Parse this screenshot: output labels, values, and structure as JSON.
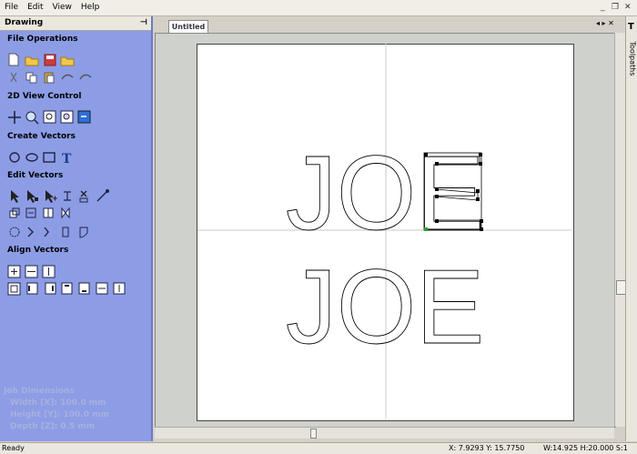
{
  "menus": [
    "File",
    "Edit",
    "View",
    "Help"
  ],
  "window_controls": [
    "_",
    "❐",
    "✕"
  ],
  "panel": {
    "title": "Drawing",
    "pin": "⊣",
    "sections": [
      "File Operations",
      "2D View Control",
      "Create Vectors",
      "Edit Vectors",
      "Align Vectors"
    ],
    "job_dimensions": {
      "title": "Job Dimensions",
      "width": "Width  [X]: 100.0 mm",
      "height": "Height [Y]: 100.0 mm",
      "depth": "Depth  [Z]: 0.5 mm"
    }
  },
  "document": {
    "tab": "Untitled",
    "nav": "◂ ▸ ✕",
    "top_text": "JOE",
    "bottom_text": "JOE"
  },
  "sidebar_tab": "Toolpaths",
  "status": {
    "left": "Ready",
    "coords": "X: 7.9293 Y: 15.7750",
    "dims": "W:14.925  H:20.000  S:1"
  },
  "colors": {
    "panel_bg": "#8c9de6",
    "selection": "#000000",
    "anchor": "#2aa52a"
  }
}
